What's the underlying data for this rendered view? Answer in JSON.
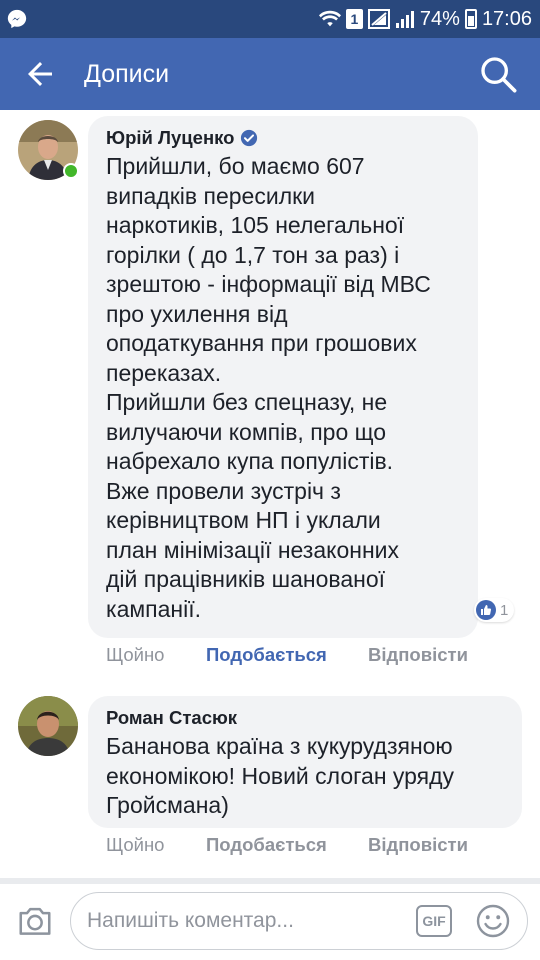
{
  "status_bar": {
    "sim_slot": "1",
    "battery": "74%",
    "time": "17:06"
  },
  "app_bar": {
    "title": "Дописи"
  },
  "comments": [
    {
      "author": "Юрій Луценко",
      "verified": true,
      "online": true,
      "text": "Прийшли, бо маємо 607\nвипадків пересилки\nнаркотиків, 105 нелегальної\nгорілки ( до 1,7 тон за раз) і\nзрештою - інформації від МВС\nпро ухилення від\nоподаткування при грошових\nпереказах.\nПрийшли без спецназу, не\nвилучаючи компів, про що\nнабрехало купа популістів.\nВже провели зустріч з\nкерівництвом НП і уклали\nплан мінімізації незаконних\nдій працівників шанованої\nкампанії.",
      "reaction_count": "1",
      "actions": {
        "time": "Щойно",
        "like": "Подобається",
        "reply": "Відповісти"
      },
      "like_active": true
    },
    {
      "author": "Роман Стасюк",
      "verified": false,
      "online": false,
      "text": "Бананова країна з кукурудзяною\nекономікою! Новий слоган уряду\nГройсмана)",
      "actions": {
        "time": "Щойно",
        "like": "Подобається",
        "reply": "Відповісти"
      },
      "like_active": false
    }
  ],
  "composer": {
    "placeholder": "Напишіть коментар...",
    "gif_label": "GIF"
  },
  "colors": {
    "status_bar": "#29487d",
    "app_bar": "#4267b2",
    "bubble": "#f2f3f5",
    "accent": "#4267b2",
    "muted": "#90949c"
  }
}
